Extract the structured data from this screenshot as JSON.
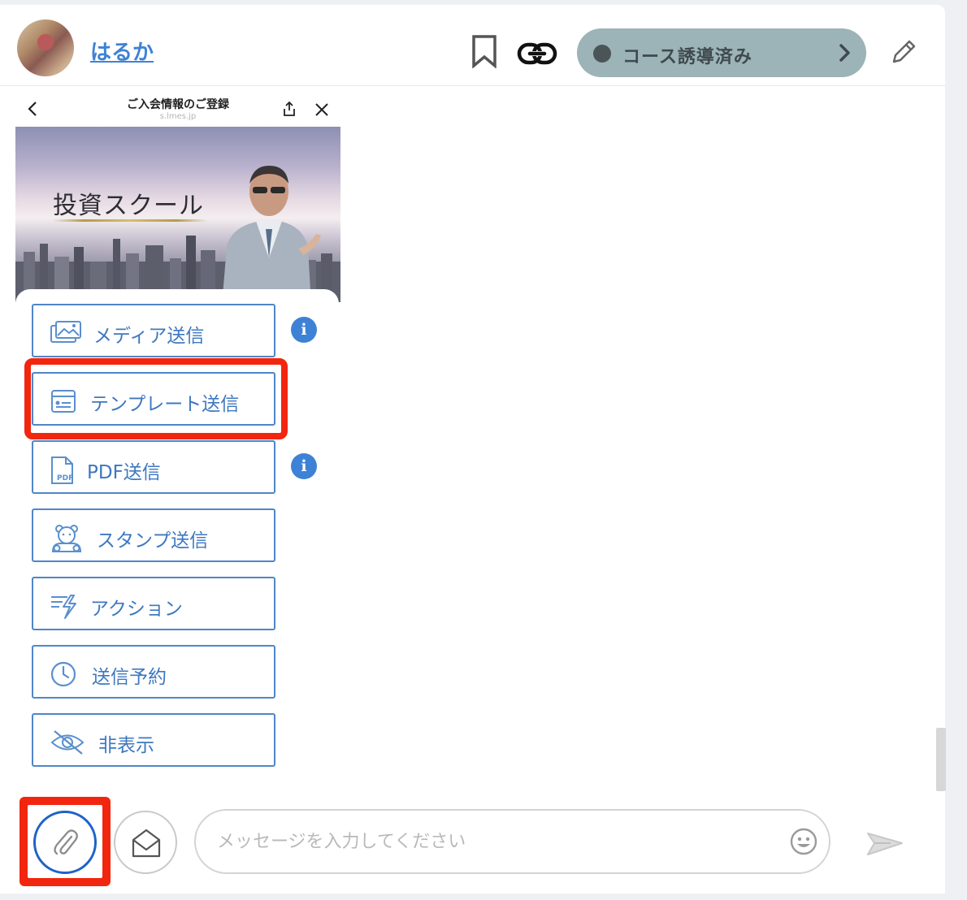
{
  "header": {
    "user_name": "はるか",
    "status_label": "コース誘導済み",
    "icons": [
      "avatar",
      "bookmark-icon",
      "link-icon",
      "chevron-right-icon",
      "pencil-icon"
    ]
  },
  "preview": {
    "title": "ご入会情報のご登録",
    "url": "s.lmes.jp",
    "hero_title": "投資スクール"
  },
  "menu": {
    "items": [
      {
        "label": "メディア送信",
        "icon": "media-icon",
        "has_info": true
      },
      {
        "label": "テンプレート送信",
        "icon": "template-icon",
        "has_info": false
      },
      {
        "label": "PDF送信",
        "icon": "pdf-icon",
        "has_info": true
      },
      {
        "label": "スタンプ送信",
        "icon": "sticker-bear-icon",
        "has_info": false
      },
      {
        "label": "アクション",
        "icon": "action-bolt-icon",
        "has_info": false
      },
      {
        "label": "送信予約",
        "icon": "clock-icon",
        "has_info": false
      },
      {
        "label": "非表示",
        "icon": "eye-slash-icon",
        "has_info": false
      }
    ],
    "info_glyph": "i"
  },
  "composer": {
    "placeholder": "メッセージを入力してください",
    "icons": [
      "paperclip-icon",
      "envelope-open-icon",
      "emoji-icon",
      "send-icon"
    ]
  },
  "colors": {
    "accent_blue": "#3e82d6",
    "menu_border": "#4f86c8",
    "status_pill": "#9cb3b8",
    "highlight_red": "#f2260f"
  }
}
